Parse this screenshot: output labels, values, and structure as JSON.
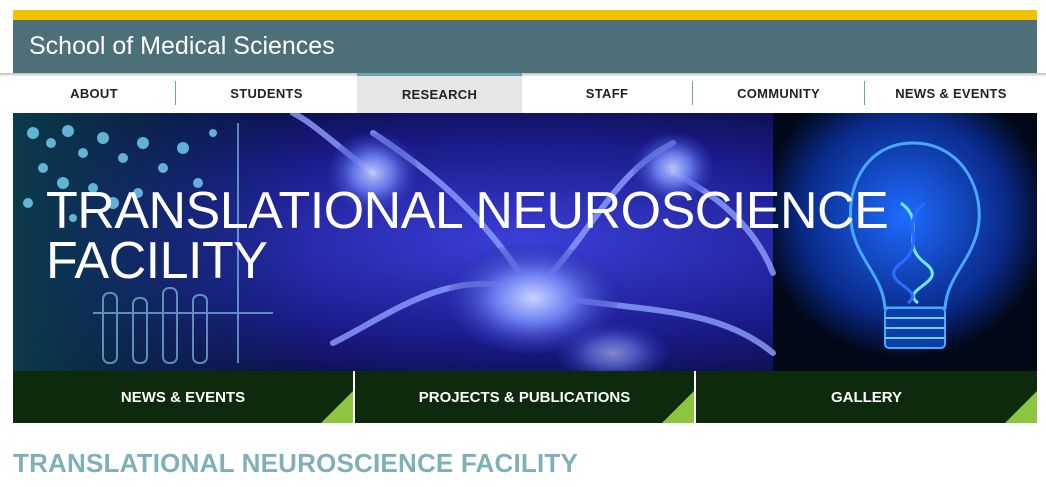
{
  "header": {
    "title": "School of Medical Sciences"
  },
  "nav": {
    "items": [
      {
        "label": "ABOUT"
      },
      {
        "label": "STUDENTS"
      },
      {
        "label": "RESEARCH"
      },
      {
        "label": "STAFF"
      },
      {
        "label": "COMMUNITY"
      },
      {
        "label": "NEWS & EVENTS"
      }
    ],
    "active": "RESEARCH"
  },
  "hero": {
    "title": "TRANSLATIONAL NEUROSCIENCE FACILITY"
  },
  "tiles": [
    {
      "label": "NEWS & EVENTS"
    },
    {
      "label": "PROJECTS & PUBLICATIONS"
    },
    {
      "label": "GALLERY"
    }
  ],
  "page": {
    "heading": "TRANSLATIONAL NEUROSCIENCE FACILITY"
  },
  "colors": {
    "accent_yellow": "#f2c200",
    "header_teal": "#4d7078",
    "tile_green": "#0d2a0d",
    "corner_green": "#8cc63f",
    "heading_teal": "#7fb0ba"
  }
}
